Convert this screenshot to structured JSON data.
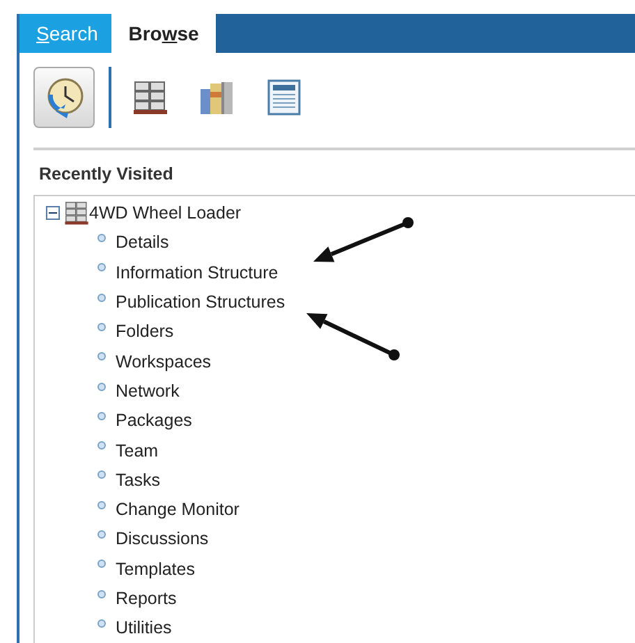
{
  "tabs": [
    {
      "mnemonic": "S",
      "label_end": "earch",
      "selected": false
    },
    {
      "label_start": "Bro",
      "mnemonic": "w",
      "label_end": "se",
      "selected": true
    }
  ],
  "toolbar": [
    {
      "kind": "history",
      "selected": true
    },
    {
      "kind": "separator"
    },
    {
      "kind": "pallet",
      "selected": false
    },
    {
      "kind": "books",
      "selected": false
    },
    {
      "kind": "document",
      "selected": false
    }
  ],
  "section_title": "Recently Visited",
  "tree": [
    {
      "label": "4WD Wheel Loader",
      "expanded": true,
      "children": [
        {
          "label": "Details"
        },
        {
          "label": "Information Structure"
        },
        {
          "label": "Publication Structures"
        },
        {
          "label": "Folders"
        },
        {
          "label": "Workspaces"
        },
        {
          "label": "Network"
        },
        {
          "label": "Packages"
        },
        {
          "label": "Team"
        },
        {
          "label": "Tasks"
        },
        {
          "label": "Change Monitor"
        },
        {
          "label": "Discussions"
        },
        {
          "label": "Templates"
        },
        {
          "label": "Reports"
        },
        {
          "label": "Utilities"
        }
      ]
    }
  ],
  "annotations": [
    {
      "kind": "arrow"
    },
    {
      "kind": "arrow"
    }
  ]
}
